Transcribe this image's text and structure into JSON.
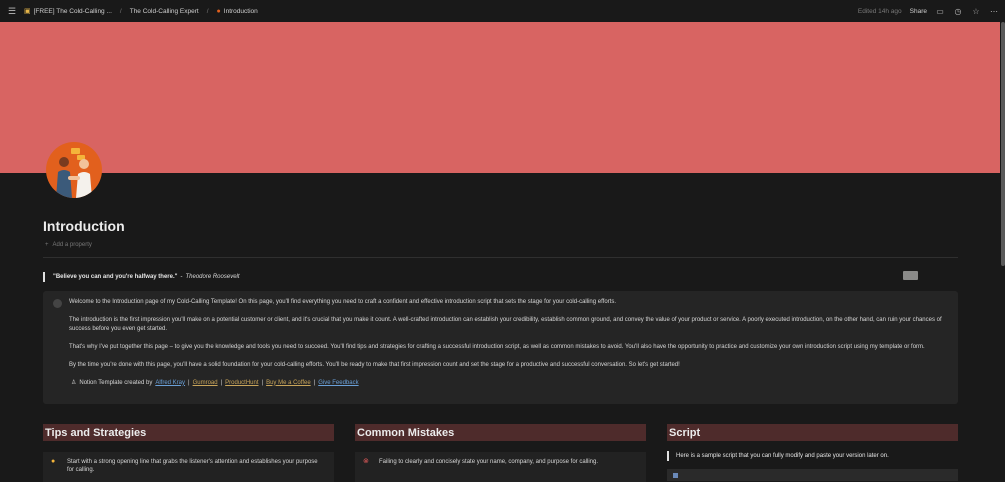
{
  "topbar": {
    "breadcrumbs": [
      {
        "icon": "folder-icon",
        "label": "[FREE] The Cold-Calling ..."
      },
      {
        "icon": "",
        "label": "The Cold-Calling Expert"
      },
      {
        "icon": "handshake-icon",
        "label": "Introduction"
      }
    ],
    "separator": "/",
    "edited": "Edited 14h ago",
    "share_label": "Share",
    "actions": [
      "comment-icon",
      "history-icon",
      "star-icon",
      "more-icon"
    ]
  },
  "page": {
    "title": "Introduction",
    "add_property": "Add a property",
    "cover_color": "#d86462",
    "icon": "handshake-icon"
  },
  "quote": {
    "text": "\"Believe you can and you're halfway there.\"",
    "dash": "-",
    "author": "Theodore Roosevelt"
  },
  "callout": {
    "paragraphs": [
      "Welcome to the Introduction page of my Cold-Calling Template! On this page, you'll find everything you need to craft a confident and effective introduction script that sets the stage for your cold-calling efforts.",
      "The introduction is the first impression you'll make on a potential customer or client, and it's crucial that you make it count. A well-crafted introduction can establish your credibility, establish common ground, and convey the value of your product or service. A poorly executed introduction, on the other hand, can ruin your chances of success before you even get started.",
      "That's why I've put together this page – to give you the knowledge and tools you need to succeed. You'll find tips and strategies for crafting a successful introduction script, as well as common mistakes to avoid. You'll also have the opportunity to practice and customize your own introduction script using my template or form.",
      "By the time you're done with this page, you'll have a solid foundation for your cold-calling efforts. You'll be ready to make that first impression count and set the stage for a productive and successful conversation. So let's get started!"
    ],
    "credit_prefix": "Notion Template created by",
    "links": [
      "Alfred Kray",
      "Gumroad",
      "ProductHunt",
      "Buy Me a Coffee",
      "Give Feedback"
    ],
    "link_sep": "|"
  },
  "columns": [
    {
      "heading": "Tips and Strategies",
      "icon": "lightbulb-icon",
      "text": "Start with a strong opening line that grabs the listener's attention and establishes your purpose for calling."
    },
    {
      "heading": "Common Mistakes",
      "icon": "x-circle-icon",
      "text": "Failing to clearly and concisely state your name, company, and purpose for calling."
    },
    {
      "heading": "Script",
      "quote": "Here is a sample script that you can fully modify and paste your version later on."
    }
  ]
}
